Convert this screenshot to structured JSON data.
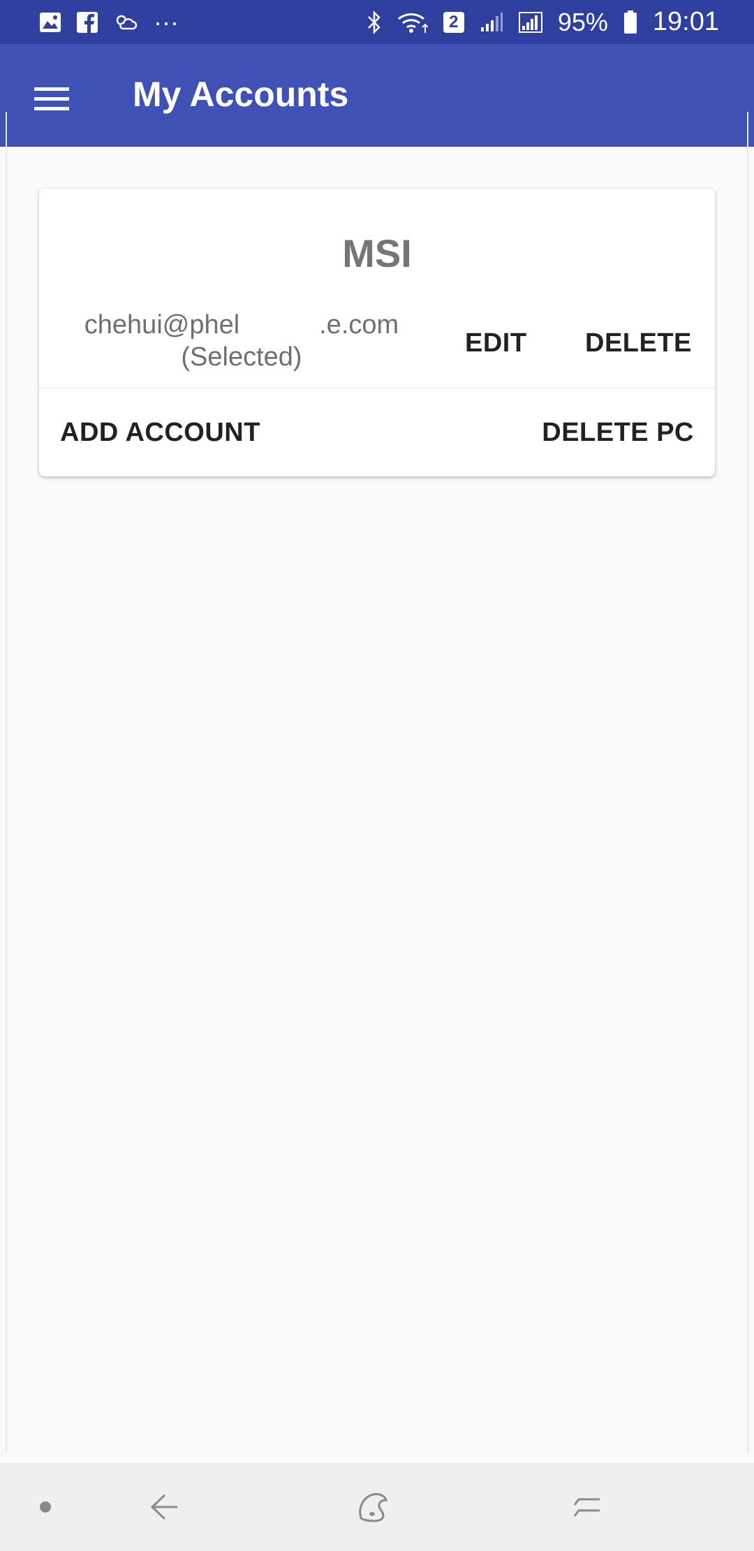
{
  "status_bar": {
    "battery_percent": "95%",
    "time": "19:01",
    "notification_count_badge": "2",
    "overflow_dots": "···",
    "left_icons": [
      "gallery-icon",
      "facebook-icon",
      "weather-icon"
    ],
    "right_icons": [
      "bluetooth-icon",
      "wifi-icon",
      "signal-icon",
      "signal-icon",
      "battery-icon"
    ]
  },
  "app_bar": {
    "title": "My Accounts",
    "menu_icon": "hamburger-menu-icon",
    "color": "#3f51b5"
  },
  "card": {
    "title": "MSI",
    "account": {
      "email": "chehui@phel   .e.com",
      "status": "(Selected)"
    },
    "edit_label": "EDIT",
    "delete_label": "DELETE",
    "add_account_label": "ADD ACCOUNT",
    "delete_pc_label": "DELETE PC"
  },
  "nav_bar": {
    "items": [
      "home-dot-icon",
      "back-icon",
      "home-icon",
      "recents-icon"
    ]
  },
  "colors": {
    "status_bar": "#2e3fa0",
    "app_bar": "#3f51b5",
    "background": "#fafafa",
    "card_title": "#757575"
  }
}
